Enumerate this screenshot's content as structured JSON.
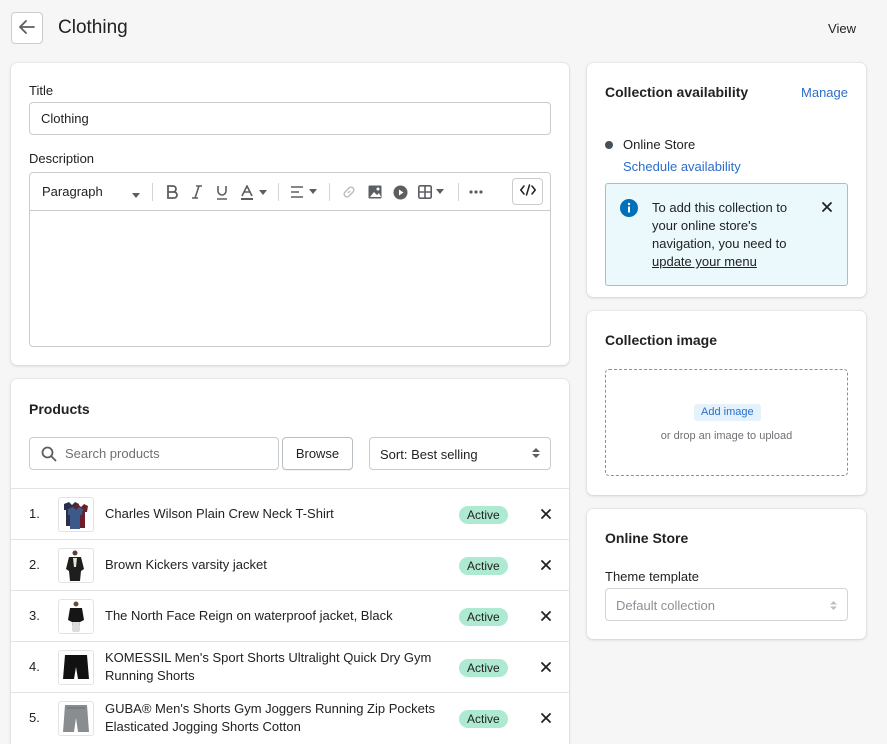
{
  "header": {
    "title": "Clothing",
    "view_label": "View"
  },
  "details": {
    "title_label": "Title",
    "title_value": "Clothing",
    "description_label": "Description",
    "format_select": "Paragraph"
  },
  "products": {
    "heading": "Products",
    "search_placeholder": "Search products",
    "browse_label": "Browse",
    "sort_label": "Sort: Best selling",
    "items": [
      {
        "num": "1.",
        "name_line1": "Charles Wilson Plain Crew Neck T-Shirt",
        "name_line2": "",
        "status": "Active"
      },
      {
        "num": "2.",
        "name_line1": "Brown Kickers varsity jacket",
        "name_line2": "",
        "status": "Active"
      },
      {
        "num": "3.",
        "name_line1": "The North Face Reign on waterproof jacket, Black",
        "name_line2": "",
        "status": "Active"
      },
      {
        "num": "4.",
        "name_line1": "KOMESSIL Men's Sport Shorts Ultralight Quick Dry Gym",
        "name_line2": "Running Shorts",
        "status": "Active"
      },
      {
        "num": "5.",
        "name_line1": "GUBA® Men's Shorts Gym Joggers Running Zip Pockets",
        "name_line2": "Elasticated Jogging Shorts Cotton",
        "status": "Active"
      }
    ]
  },
  "availability": {
    "heading": "Collection availability",
    "manage_label": "Manage",
    "channel": "Online Store",
    "schedule_label": "Schedule availability",
    "banner_text": "To add this collection to your online store's navigation, you need to",
    "banner_link": "update your menu"
  },
  "collection_image": {
    "heading": "Collection image",
    "add_label": "Add image",
    "hint": "or drop an image to upload"
  },
  "online_store": {
    "heading": "Online Store",
    "template_label": "Theme template",
    "template_value": "Default collection"
  },
  "colors": {
    "accent": "#2c6ecb",
    "badge_active": "#aee9d1",
    "banner_bg": "#ebf9fc",
    "info_icon": "#00a0ac"
  }
}
